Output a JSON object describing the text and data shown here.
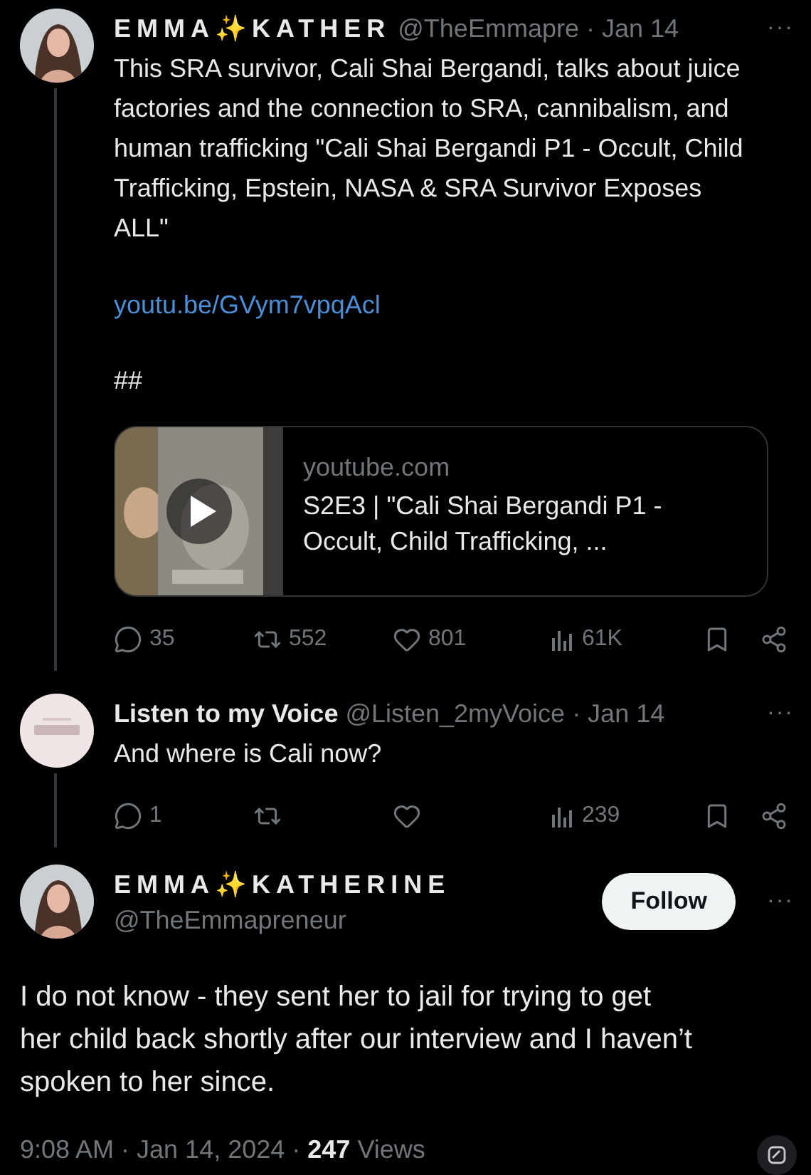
{
  "thread": [
    {
      "name": "EMMA✨KATHER",
      "handle": "@TheEmmapre",
      "date": "· Jan 14",
      "more": "···",
      "text": [
        "This SRA survivor, Cali Shai Bergandi, talks about juice factories and the connection to SRA, cannibalism, and human trafficking \"Cali Shai Bergandi P1 - Occult, Child Trafficking, Epstein, NASA & SRA Survivor Exposes ALL\""
      ],
      "link": "youtu.be/GVym7vpqAcl",
      "tail": "##",
      "card": {
        "domain": "youtube.com",
        "title": "S2E3 | \"Cali Shai Bergandi P1 - Occult, Child Trafficking, ..."
      },
      "stats": [
        {
          "kind": "reply",
          "count": "35"
        },
        {
          "kind": "repost",
          "count": "552"
        },
        {
          "kind": "like",
          "count": "801"
        },
        {
          "kind": "views",
          "count": "61K"
        }
      ]
    },
    {
      "name": "Listen to my Voice",
      "handle": "@Listen_2myVoice",
      "date": "· Jan 14",
      "more": "···",
      "text": [
        "And where is Cali now?"
      ],
      "stats": [
        {
          "kind": "reply",
          "count": "1"
        },
        {
          "kind": "repost"
        },
        {
          "kind": "like"
        },
        {
          "kind": "views",
          "count": "239"
        }
      ]
    }
  ],
  "focal": {
    "name": "EMMA✨KATHERINE",
    "handle": "@TheEmmapreneur",
    "follow": "Follow",
    "more": "···",
    "text": "I do not know - they sent her to jail for trying to get her child back shortly after our interview and I haven’t spoken to her since.",
    "time": "9:08 AM · Jan 14, 2024 · ",
    "views_count": "247",
    "views_label": "Views"
  }
}
